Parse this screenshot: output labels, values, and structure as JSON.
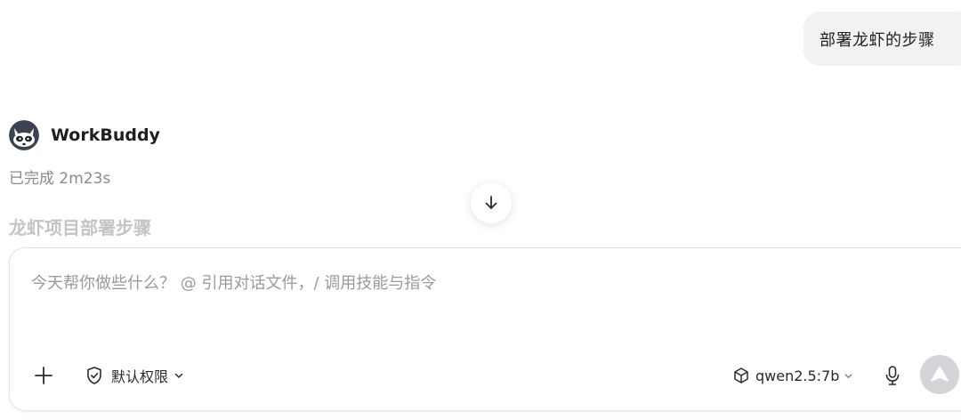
{
  "conversation": {
    "user_message": "部署龙虾的步骤",
    "agent": {
      "name": "WorkBuddy",
      "avatar_icon": "raccoon-avatar",
      "status": "已完成 2m23s"
    },
    "section_heading": "龙虾项目部署步骤"
  },
  "scroll_down_icon": "arrow-down-icon",
  "composer": {
    "placeholder": "今天帮你做些什么？ @ 引用对话文件，/ 调用技能与指令",
    "value": "",
    "add_icon": "plus-icon",
    "permission": {
      "icon": "shield-check-icon",
      "label": "默认权限"
    },
    "model": {
      "icon": "cube-icon",
      "label": "qwen2.5:7b"
    },
    "mic_icon": "microphone-icon",
    "send_icon": "send-arrow-icon"
  },
  "colors": {
    "bubble_bg": "#f2f2f4",
    "muted_text": "#8a8a8a",
    "heading_faded": "#c4c4c4",
    "send_disabled": "#d4d4d8",
    "border": "#e3e3e6"
  }
}
